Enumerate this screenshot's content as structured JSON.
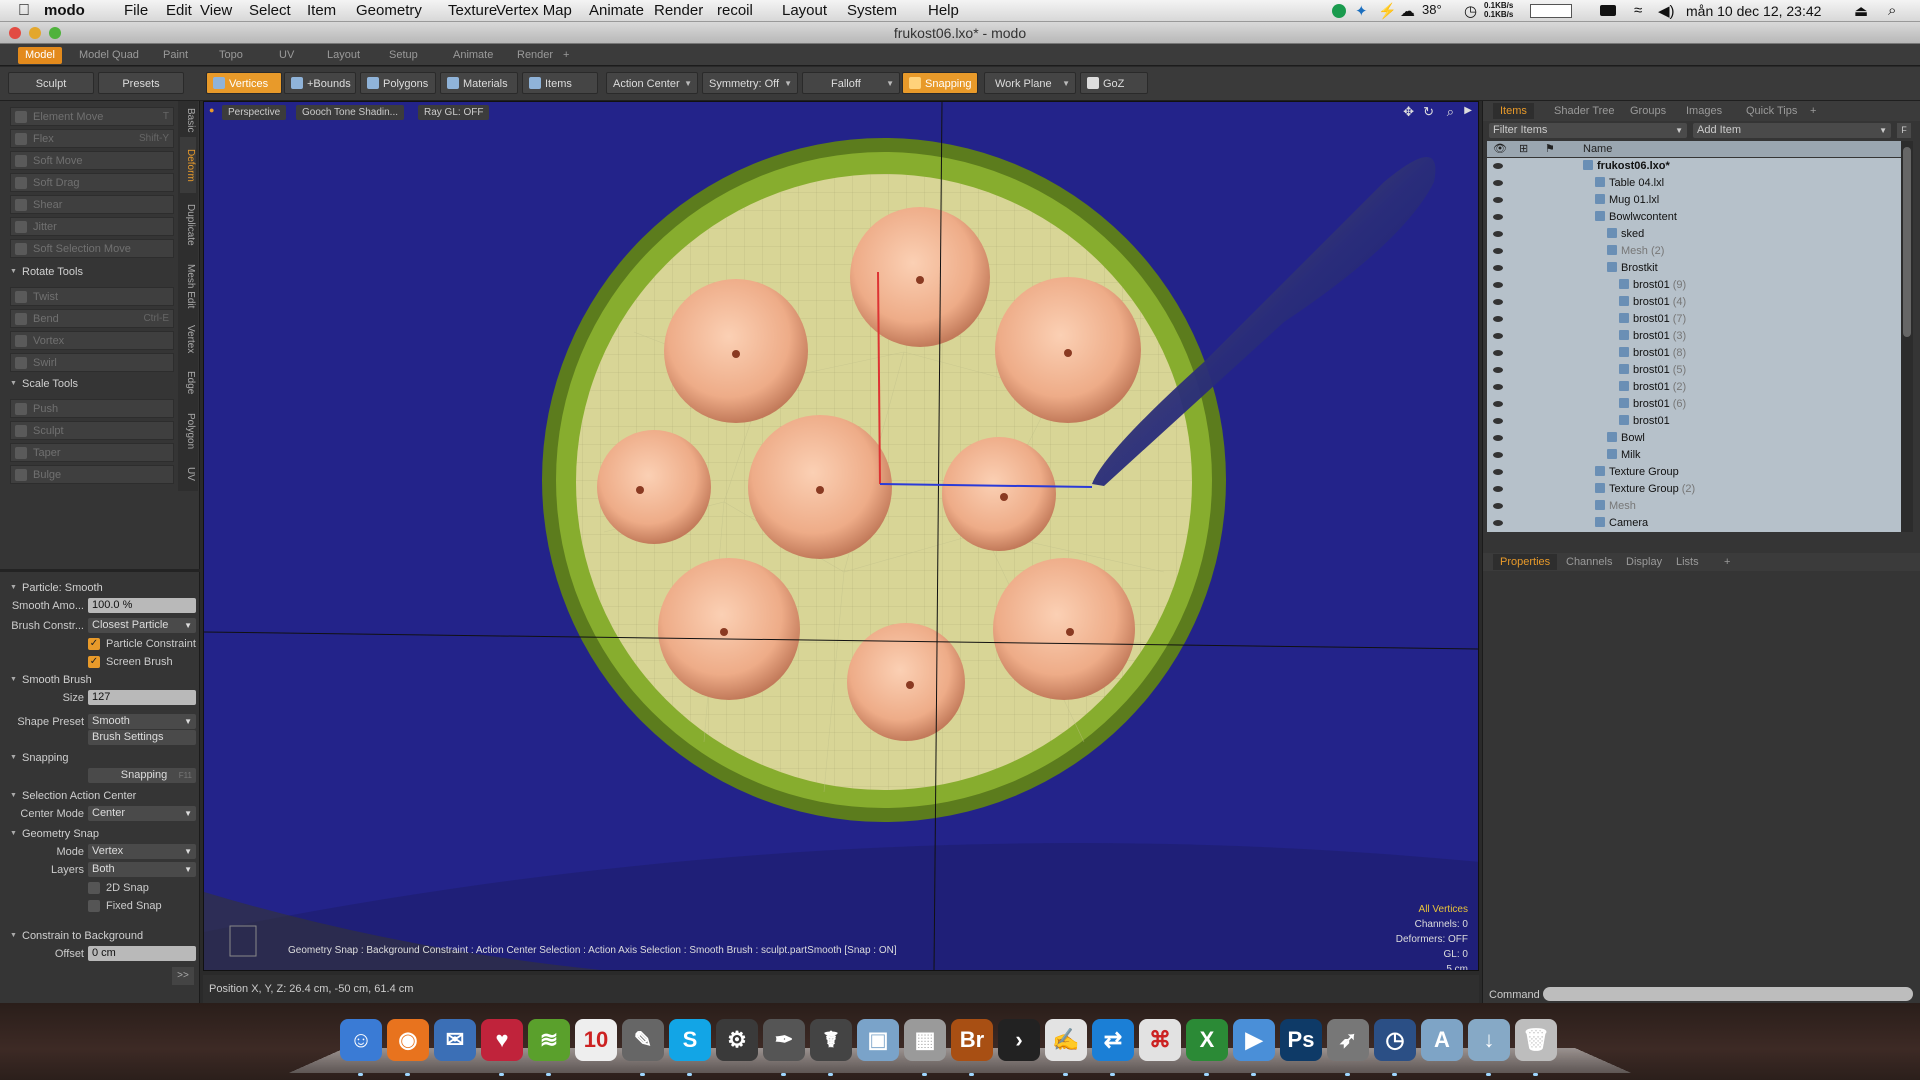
{
  "menubar": {
    "apple": "",
    "app": "modo",
    "items": [
      "File",
      "Edit",
      "View",
      "Select",
      "Item",
      "Geometry",
      "Texture",
      "Vertex Map",
      "Animate",
      "Render",
      "recoil",
      "Layout",
      "System",
      "Help"
    ],
    "temp": "38°",
    "net_up": "0.1KB/s",
    "net_down": "0.1KB/s",
    "clock": "mån 10 dec 12, 23:42"
  },
  "window": {
    "title": "frukost06.lxo* - modo"
  },
  "layout_tabs": [
    "Model",
    "Model Quad",
    "Paint",
    "Topo",
    "UV",
    "Layout",
    "Setup",
    "Animate",
    "Render",
    "+"
  ],
  "toolbar": {
    "sculpt": "Sculpt",
    "presets": "Presets",
    "vertices": "Vertices",
    "bounds": "+Bounds",
    "polygons": "Polygons",
    "materials": "Materials",
    "items": "Items",
    "action_center": "Action Center",
    "symmetry": "Symmetry: Off",
    "falloff": "Falloff",
    "snapping": "Snapping",
    "work_plane": "Work Plane",
    "goz": "GoZ"
  },
  "left_tools": [
    {
      "label": "Element Move",
      "shortcut": "T"
    },
    {
      "label": "Flex",
      "shortcut": "Shift-Y"
    },
    {
      "label": "Soft Move",
      "shortcut": ""
    },
    {
      "label": "Soft Drag",
      "shortcut": ""
    },
    {
      "label": "Shear",
      "shortcut": ""
    },
    {
      "label": "Jitter",
      "shortcut": ""
    },
    {
      "label": "Soft Selection Move",
      "shortcut": ""
    }
  ],
  "rotate_tools": {
    "title": "Rotate Tools",
    "items": [
      {
        "label": "Twist",
        "shortcut": ""
      },
      {
        "label": "Bend",
        "shortcut": "Ctrl-E"
      },
      {
        "label": "Vortex",
        "shortcut": ""
      },
      {
        "label": "Swirl",
        "shortcut": ""
      }
    ]
  },
  "scale_tools": {
    "title": "Scale Tools",
    "items": [
      {
        "label": "Push"
      },
      {
        "label": "Sculpt"
      },
      {
        "label": "Taper"
      },
      {
        "label": "Bulge"
      }
    ]
  },
  "vertical_tabs": [
    "Basic",
    "Deform",
    "Duplicate",
    "Mesh Edit",
    "Vertex",
    "Edge",
    "Polygon",
    "UV"
  ],
  "props": {
    "particle_title": "Particle: Smooth",
    "smooth_amount_label": "Smooth Amo...",
    "smooth_amount": "100.0 %",
    "brush_constr_label": "Brush Constr...",
    "brush_constr": "Closest Particle",
    "particle_constraint": "Particle Constraint",
    "screen_brush": "Screen Brush",
    "smooth_brush_title": "Smooth Brush",
    "size_label": "Size",
    "size": "127",
    "shape_preset_label": "Shape Preset",
    "shape_preset": "Smooth",
    "brush_settings": "Brush Settings",
    "snapping_title": "Snapping",
    "snapping_btn": "Snapping",
    "snapping_key": "F11",
    "sel_action_center": "Selection Action Center",
    "center_mode_label": "Center Mode",
    "center_mode": "Center",
    "geometry_snap": "Geometry Snap",
    "mode_label": "Mode",
    "mode": "Vertex",
    "layers_label": "Layers",
    "layers": "Both",
    "snap2d": "2D Snap",
    "fixed_snap": "Fixed Snap",
    "constrain_bg": "Constrain to Background",
    "offset_label": "Offset",
    "offset": "0 cm",
    "more": ">>"
  },
  "viewport": {
    "perspective": "Perspective",
    "shading": "Gooch Tone Shadin...",
    "raygl": "Ray GL: OFF",
    "status": "Geometry Snap : Background Constraint  : Action Center Selection : Action Axis Selection : Smooth Brush : sculpt.partSmooth  [Snap : ON]",
    "info": [
      "All Vertices",
      "Channels: 0",
      "Deformers: OFF",
      "GL: 0",
      "5 cm"
    ]
  },
  "position": "Position X, Y, Z:   26.4 cm, -50 cm, 61.4 cm",
  "right": {
    "tabs": [
      "Items",
      "Shader Tree",
      "Groups",
      "Images",
      "Quick Tips",
      "+"
    ],
    "filter": "Filter Items",
    "add_item": "Add Item",
    "name_header": "Name",
    "tree": [
      {
        "label": "frukost06.lxo*",
        "count": "",
        "indent": 0,
        "bold": true,
        "dim": false
      },
      {
        "label": "Table 04.lxl",
        "count": "",
        "indent": 1,
        "dim": false
      },
      {
        "label": "Mug 01.lxl",
        "count": "",
        "indent": 1,
        "dim": false
      },
      {
        "label": "Bowlwcontent",
        "count": "",
        "indent": 1,
        "dim": false
      },
      {
        "label": "sked",
        "count": "",
        "indent": 2,
        "dim": false
      },
      {
        "label": "Mesh",
        "count": "(2)",
        "indent": 2,
        "dim": true
      },
      {
        "label": "Brostkit",
        "count": "",
        "indent": 2,
        "dim": false
      },
      {
        "label": "brost01",
        "count": "(9)",
        "indent": 3,
        "dim": false
      },
      {
        "label": "brost01",
        "count": "(4)",
        "indent": 3,
        "dim": false
      },
      {
        "label": "brost01",
        "count": "(7)",
        "indent": 3,
        "dim": false
      },
      {
        "label": "brost01",
        "count": "(3)",
        "indent": 3,
        "dim": false
      },
      {
        "label": "brost01",
        "count": "(8)",
        "indent": 3,
        "dim": false
      },
      {
        "label": "brost01",
        "count": "(5)",
        "indent": 3,
        "dim": false
      },
      {
        "label": "brost01",
        "count": "(2)",
        "indent": 3,
        "dim": false
      },
      {
        "label": "brost01",
        "count": "(6)",
        "indent": 3,
        "dim": false
      },
      {
        "label": "brost01",
        "count": "",
        "indent": 3,
        "dim": false
      },
      {
        "label": "Bowl",
        "count": "",
        "indent": 2,
        "dim": false
      },
      {
        "label": "Milk",
        "count": "",
        "indent": 2,
        "dim": false
      },
      {
        "label": "Texture Group",
        "count": "",
        "indent": 1,
        "dim": false
      },
      {
        "label": "Texture Group",
        "count": "(2)",
        "indent": 1,
        "dim": false
      },
      {
        "label": "Mesh",
        "count": "",
        "indent": 1,
        "dim": true
      },
      {
        "label": "Camera",
        "count": "",
        "indent": 1,
        "dim": false
      }
    ],
    "prop_tabs": [
      "Properties",
      "Channels",
      "Display",
      "Lists",
      "+"
    ],
    "command_label": "Command"
  },
  "dock": [
    {
      "name": "finder-icon",
      "color": "#3a7bd5",
      "glyph": "☺"
    },
    {
      "name": "firefox-icon",
      "color": "#e8731e",
      "glyph": "◉"
    },
    {
      "name": "thunderbird-icon",
      "color": "#3b6fb6",
      "glyph": "✉"
    },
    {
      "name": "health-icon",
      "color": "#c0233b",
      "glyph": "♥"
    },
    {
      "name": "spotify-icon",
      "color": "#5aa02c",
      "glyph": "≋"
    },
    {
      "name": "calendar-icon",
      "color": "#eeeeee",
      "glyph": "10"
    },
    {
      "name": "modo-icon",
      "color": "#666666",
      "glyph": "✎"
    },
    {
      "name": "skype-icon",
      "color": "#12a5e6",
      "glyph": "S"
    },
    {
      "name": "steam-icon",
      "color": "#3a3a3a",
      "glyph": "⚙"
    },
    {
      "name": "quill-icon",
      "color": "#555555",
      "glyph": "✒"
    },
    {
      "name": "runner-icon",
      "color": "#444444",
      "glyph": "☤"
    },
    {
      "name": "preview-icon",
      "color": "#7aa3c9",
      "glyph": "▣"
    },
    {
      "name": "calculator-icon",
      "color": "#9a9a9a",
      "glyph": "▦"
    },
    {
      "name": "bridge-icon",
      "color": "#a84f13",
      "glyph": "Br"
    },
    {
      "name": "plex-icon",
      "color": "#222222",
      "glyph": "›"
    },
    {
      "name": "notes-icon",
      "color": "#e3e3e3",
      "glyph": "✍"
    },
    {
      "name": "teamviewer-icon",
      "color": "#1b7fd6",
      "glyph": "⇄"
    },
    {
      "name": "acrobat-icon",
      "color": "#e2e2e2",
      "glyph": "⌘"
    },
    {
      "name": "excel-icon",
      "color": "#2b8a36",
      "glyph": "X"
    },
    {
      "name": "quicktime-icon",
      "color": "#4a8fd8",
      "glyph": "▶"
    },
    {
      "name": "photoshop-icon",
      "color": "#0e3a67",
      "glyph": "Ps"
    },
    {
      "name": "launchpad-icon",
      "color": "#777777",
      "glyph": "➶"
    },
    {
      "name": "timemachine-icon",
      "color": "#2b4f85",
      "glyph": "◷"
    },
    {
      "name": "applications-folder-icon",
      "color": "#7ea4c6",
      "glyph": "A"
    },
    {
      "name": "downloads-folder-icon",
      "color": "#86a9c6",
      "glyph": "↓"
    },
    {
      "name": "trash-icon",
      "color": "#bdbdbd",
      "glyph": "🗑"
    }
  ],
  "colors": {
    "accent": "#e89a2a",
    "viewport_bg": "#23238a",
    "bowl_green": "#7ca22a",
    "cream": "#d8d596",
    "tree_bg": "#b6c1ca"
  }
}
